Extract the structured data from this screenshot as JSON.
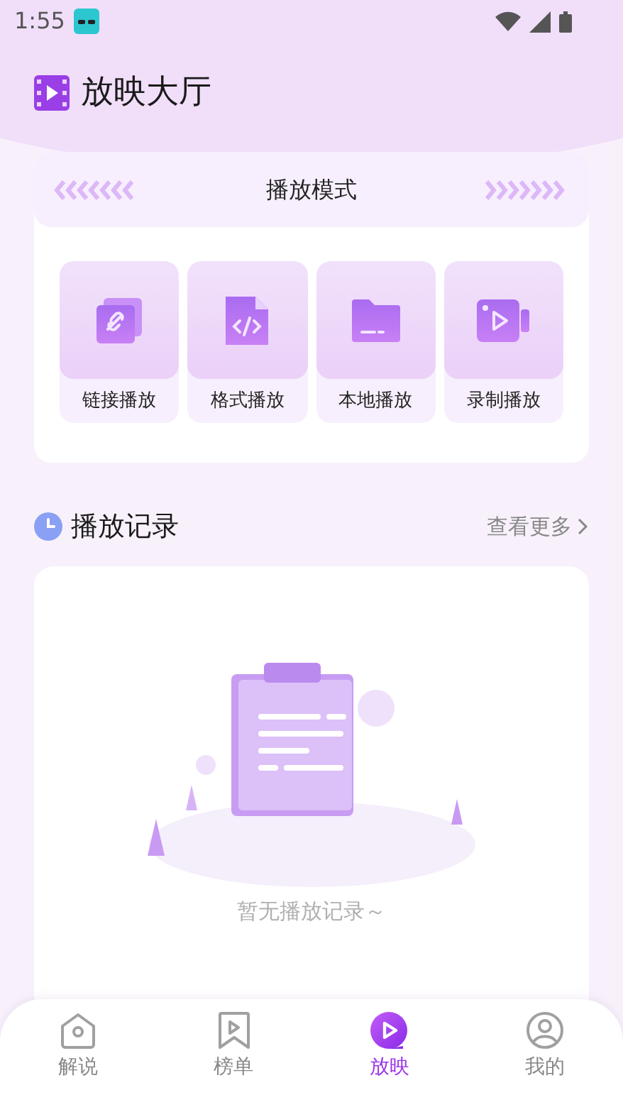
{
  "status_bar": {
    "time": "1:55"
  },
  "header": {
    "title": "放映大厅"
  },
  "play_modes": {
    "title": "播放模式",
    "items": [
      {
        "label": "链接播放",
        "kind": "link"
      },
      {
        "label": "格式播放",
        "kind": "code"
      },
      {
        "label": "本地播放",
        "kind": "folder"
      },
      {
        "label": "录制播放",
        "kind": "video"
      }
    ]
  },
  "history": {
    "title": "播放记录",
    "more": "查看更多",
    "empty_text": "暂无播放记录～"
  },
  "tab_bar": [
    {
      "label": "解说",
      "kind": "home",
      "selected": false
    },
    {
      "label": "榜单",
      "kind": "bookmark",
      "selected": false
    },
    {
      "label": "放映",
      "kind": "play",
      "selected": true
    },
    {
      "label": "我的",
      "kind": "user",
      "selected": false
    }
  ]
}
